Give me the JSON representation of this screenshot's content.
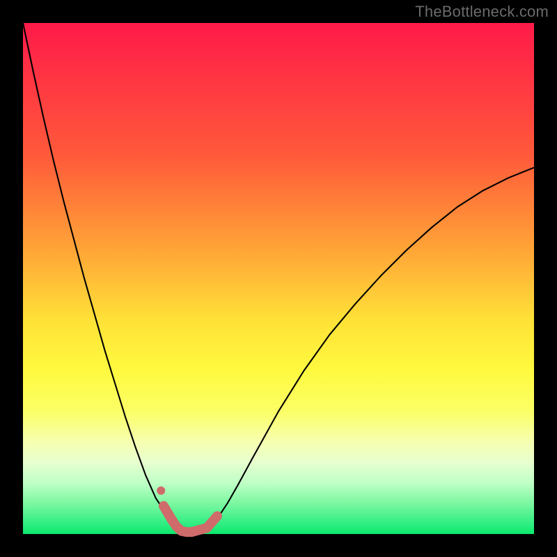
{
  "watermark": "TheBottleneck.com",
  "frame": {
    "outer_size_px": 800,
    "border_px": 33,
    "border_color": "#000000"
  },
  "gradient": {
    "stops": [
      {
        "pct": 0,
        "color": "#ff1a49"
      },
      {
        "pct": 26,
        "color": "#ff5a3a"
      },
      {
        "pct": 45,
        "color": "#ffa737"
      },
      {
        "pct": 58,
        "color": "#ffe137"
      },
      {
        "pct": 68,
        "color": "#fff93f"
      },
      {
        "pct": 76,
        "color": "#fbff66"
      },
      {
        "pct": 82,
        "color": "#f6ffb0"
      },
      {
        "pct": 86,
        "color": "#e7ffcf"
      },
      {
        "pct": 90,
        "color": "#bfffc6"
      },
      {
        "pct": 94,
        "color": "#7cf7a1"
      },
      {
        "pct": 98,
        "color": "#2fee82"
      },
      {
        "pct": 100,
        "color": "#0be86b"
      }
    ]
  },
  "chart_data": {
    "type": "line",
    "title": "",
    "xlabel": "",
    "ylabel": "",
    "xlim": [
      0,
      1
    ],
    "ylim": [
      0,
      1
    ],
    "series": [
      {
        "name": "bottleneck-curve",
        "stroke": "#000000",
        "stroke_width": 2.1,
        "x": [
          0.0,
          0.02,
          0.04,
          0.06,
          0.08,
          0.1,
          0.12,
          0.14,
          0.16,
          0.18,
          0.2,
          0.22,
          0.24,
          0.26,
          0.28,
          0.3,
          0.305,
          0.31,
          0.32,
          0.33,
          0.34,
          0.35,
          0.36,
          0.38,
          0.4,
          0.42,
          0.45,
          0.5,
          0.55,
          0.6,
          0.65,
          0.7,
          0.75,
          0.8,
          0.85,
          0.9,
          0.95,
          1.0
        ],
        "y": [
          1.0,
          0.905,
          0.815,
          0.73,
          0.65,
          0.575,
          0.5,
          0.43,
          0.36,
          0.295,
          0.23,
          0.17,
          0.115,
          0.07,
          0.04,
          0.015,
          0.008,
          0.005,
          0.003,
          0.002,
          0.003,
          0.005,
          0.01,
          0.03,
          0.06,
          0.095,
          0.15,
          0.24,
          0.32,
          0.39,
          0.45,
          0.505,
          0.555,
          0.6,
          0.64,
          0.672,
          0.697,
          0.717
        ]
      },
      {
        "name": "highlight-segment",
        "stroke": "#cf6b6b",
        "stroke_width": 14,
        "x": [
          0.275,
          0.29,
          0.3,
          0.31,
          0.32,
          0.33,
          0.345,
          0.36,
          0.38
        ],
        "y": [
          0.055,
          0.03,
          0.015,
          0.006,
          0.004,
          0.004,
          0.008,
          0.012,
          0.035
        ]
      }
    ],
    "points": [
      {
        "name": "marker-dot",
        "x": 0.27,
        "y": 0.085,
        "r": 6,
        "fill": "#cf6b6b"
      }
    ]
  }
}
